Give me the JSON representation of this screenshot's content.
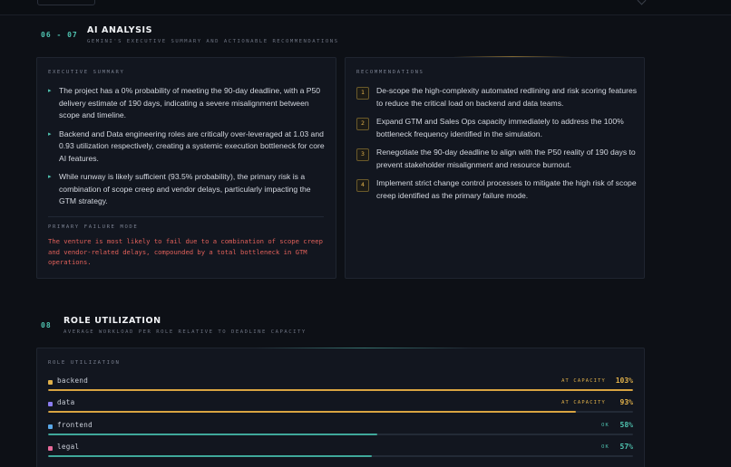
{
  "ai_section": {
    "number": "06 - 07",
    "title": "AI ANALYSIS",
    "subtitle": "GEMINI'S EXECUTIVE SUMMARY AND ACTIONABLE RECOMMENDATIONS"
  },
  "executive_summary": {
    "label": "EXECUTIVE SUMMARY",
    "bullets": [
      "The project has a 0% probability of meeting the 90-day deadline, with a P50 delivery estimate of 190 days, indicating a severe misalignment between scope and timeline.",
      "Backend and Data engineering roles are critically over-leveraged at 1.03 and 0.93 utilization respectively, creating a systemic execution bottleneck for core AI features.",
      "While runway is likely sufficient (93.5% probability), the primary risk is a combination of scope creep and vendor delays, particularly impacting the GTM strategy."
    ],
    "failure_label": "PRIMARY FAILURE MODE",
    "failure_text": "The venture is most likely to fail due to a combination of scope creep and vendor-related delays, compounded by a total bottleneck in GTM operations."
  },
  "recommendations": {
    "label": "RECOMMENDATIONS",
    "items": [
      {
        "num": "1",
        "text": "De-scope the high-complexity automated redlining and risk scoring features to reduce the critical load on backend and data teams."
      },
      {
        "num": "2",
        "text": "Expand GTM and Sales Ops capacity immediately to address the 100% bottleneck frequency identified in the simulation."
      },
      {
        "num": "3",
        "text": "Renegotiate the 90-day deadline to align with the P50 reality of 190 days to prevent stakeholder misalignment and resource burnout."
      },
      {
        "num": "4",
        "text": "Implement strict change control processes to mitigate the high risk of scope creep identified as the primary failure mode."
      }
    ]
  },
  "role_section": {
    "number": "08",
    "title": "ROLE UTILIZATION",
    "subtitle": "AVERAGE WORKLOAD PER ROLE RELATIVE TO DEADLINE CAPACITY"
  },
  "role_utilization": {
    "label": "ROLE UTILIZATION",
    "roles": [
      {
        "name": "backend",
        "status": "AT CAPACITY",
        "pct_label": "103%",
        "value": 103,
        "color": "#e0b04a",
        "status_color": "#e0b04a"
      },
      {
        "name": "data",
        "status": "AT CAPACITY",
        "pct_label": "93%",
        "value": 93,
        "color": "#8b7cf0",
        "status_color": "#e0b04a"
      },
      {
        "name": "frontend",
        "status": "OK",
        "pct_label": "58%",
        "value": 58,
        "color": "#5aa8e8",
        "status_color": "#4fc3b0"
      },
      {
        "name": "legal",
        "status": "OK",
        "pct_label": "57%",
        "value": 57,
        "color": "#e86a9a",
        "status_color": "#4fc3b0"
      }
    ]
  }
}
